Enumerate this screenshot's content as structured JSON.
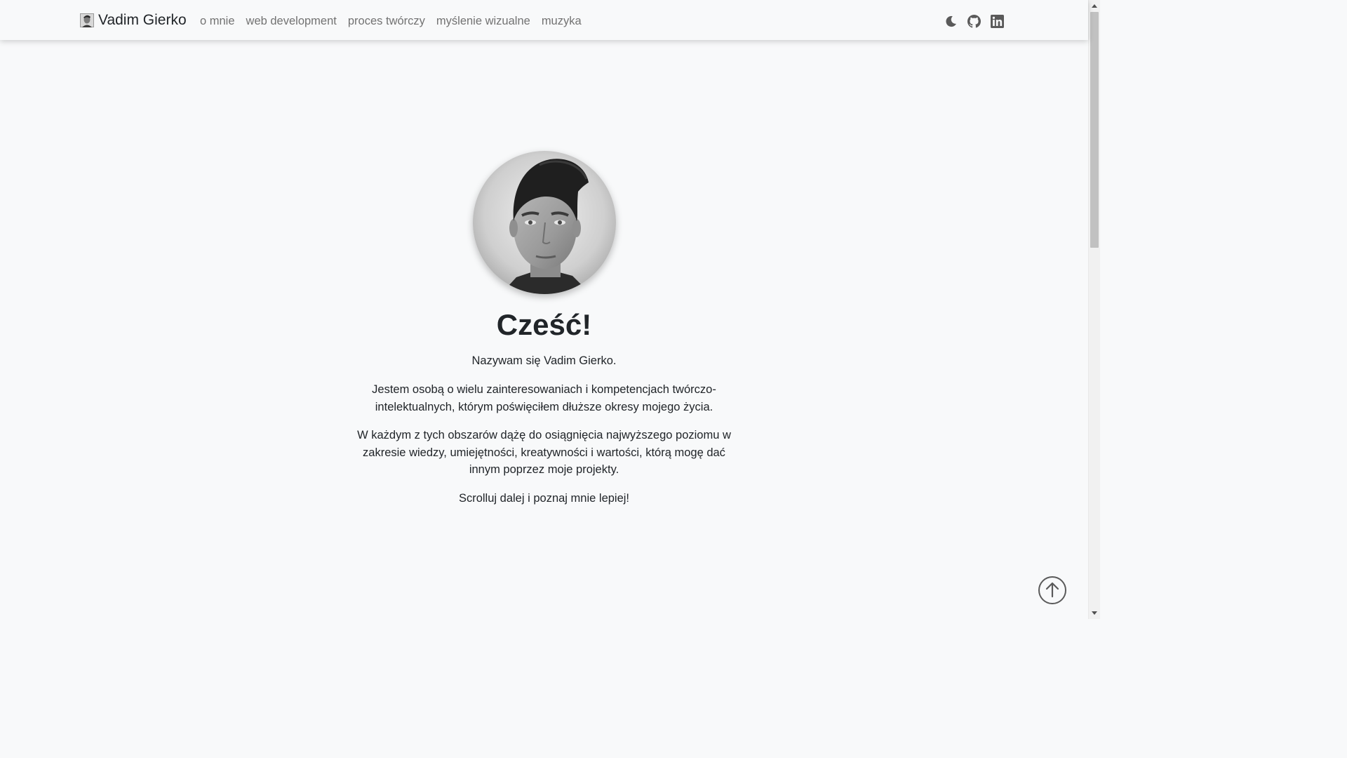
{
  "navbar": {
    "brand": "Vadim Gierko",
    "links": [
      {
        "label": "o mnie"
      },
      {
        "label": "web development"
      },
      {
        "label": "proces twórczy"
      },
      {
        "label": "myślenie wizualne"
      },
      {
        "label": "muzyka"
      }
    ],
    "icons": [
      "moon-icon",
      "github-icon",
      "linkedin-icon"
    ]
  },
  "hero": {
    "title": "Cześć!",
    "paragraphs": [
      "Nazywam się Vadim Gierko.",
      "Jestem osobą o wielu zainteresowaniach i kompetencjach twórczo-intelektualnych, którym poświęciłem dłuższe okresy mojego życia.",
      "W każdym z tych obszarów dążę do osiągnięcia najwyższego poziomu w zakresie wiedzy, umiejętności, kreatywności i wartości, którą mogę dać innym poprzez moje projekty.",
      "Scrolluj dalej i poznaj mnie lepiej!"
    ]
  },
  "back_to_top": {
    "icon": "arrow-up-icon"
  },
  "colors": {
    "background": "#f8f9fa",
    "text": "#212529",
    "nav_link": "#727272",
    "icon": "#5a5a5a"
  }
}
